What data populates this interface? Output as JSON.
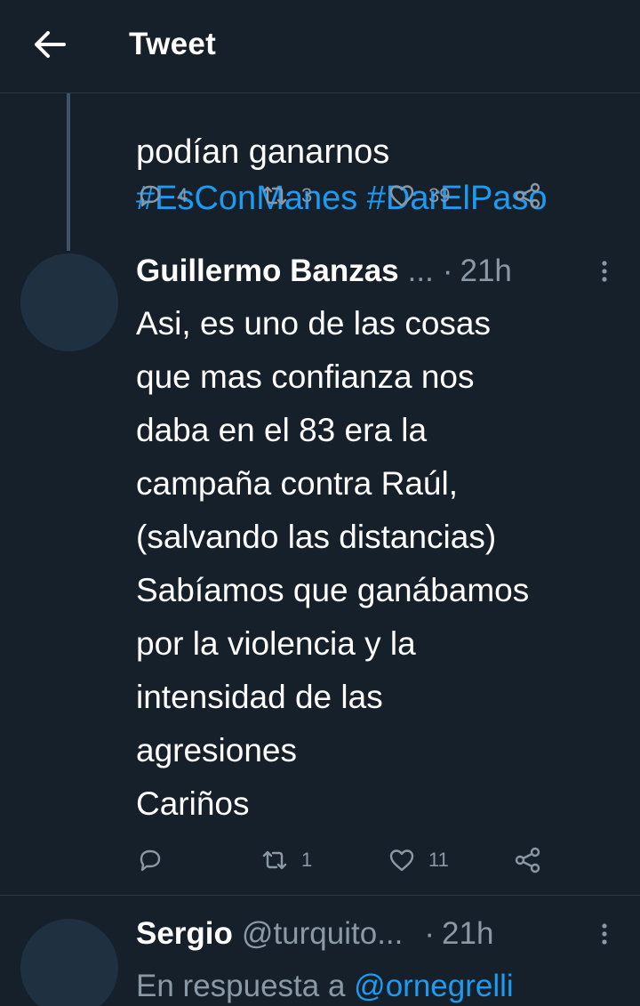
{
  "header": {
    "title": "Tweet"
  },
  "previous_tweet": {
    "text_partial": "podían ganarnos",
    "hashtags": "#EsConManes #DarElPaso",
    "actions": {
      "replies": "4",
      "retweets": "3",
      "likes": "39"
    }
  },
  "tweets": [
    {
      "name": "Guillermo Banzas",
      "handle": "...",
      "time": "21h",
      "text": "Asi, es uno de las cosas\nque mas confianza nos\ndaba en el 83 era la\ncampaña contra Raúl,\n(salvando las distancias)\nSabíamos que ganábamos\npor la violencia y la\nintensidad de las\nagresiones\nCariños",
      "actions": {
        "replies": "",
        "retweets": "1",
        "likes": "11"
      }
    },
    {
      "name": "Sergio",
      "handle": "@turquito...",
      "time": "21h",
      "reply_prefix": "En respuesta a",
      "reply_mention": "@ornegrelli"
    }
  ],
  "separator": "·",
  "icons": {
    "back": "arrow-left-icon",
    "reply": "reply-icon",
    "retweet": "retweet-icon",
    "like": "heart-icon",
    "share": "share-icon",
    "more": "more-vertical-icon"
  },
  "colors": {
    "background": "#15202b",
    "accent": "#1d9bf0",
    "muted": "#8b98a5"
  }
}
